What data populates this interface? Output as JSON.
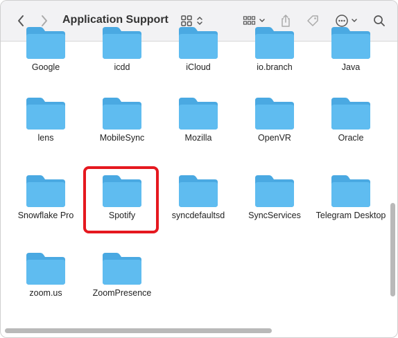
{
  "toolbar": {
    "title": "Application Support",
    "icons": [
      "chevron-left-icon",
      "chevron-right-icon",
      "grid-view-icon",
      "sort-icon",
      "group-icon",
      "share-icon",
      "tag-icon",
      "more-icon",
      "search-icon"
    ]
  },
  "files": [
    {
      "name": "Google"
    },
    {
      "name": "icdd"
    },
    {
      "name": "iCloud"
    },
    {
      "name": "io.branch"
    },
    {
      "name": "Java"
    },
    {
      "name": "lens"
    },
    {
      "name": "MobileSync"
    },
    {
      "name": "Mozilla"
    },
    {
      "name": "OpenVR"
    },
    {
      "name": "Oracle"
    },
    {
      "name": "Snowflake Pro"
    },
    {
      "name": "Spotify"
    },
    {
      "name": "syncdefaultsd"
    },
    {
      "name": "SyncServices"
    },
    {
      "name": "Telegram Desktop"
    },
    {
      "name": "zoom.us"
    },
    {
      "name": "ZoomPresence"
    }
  ],
  "highlighted": "Spotify",
  "colors": {
    "folder_body": "#5fbcf0",
    "folder_tab": "#4aa9e2",
    "highlight": "#e5181f"
  }
}
